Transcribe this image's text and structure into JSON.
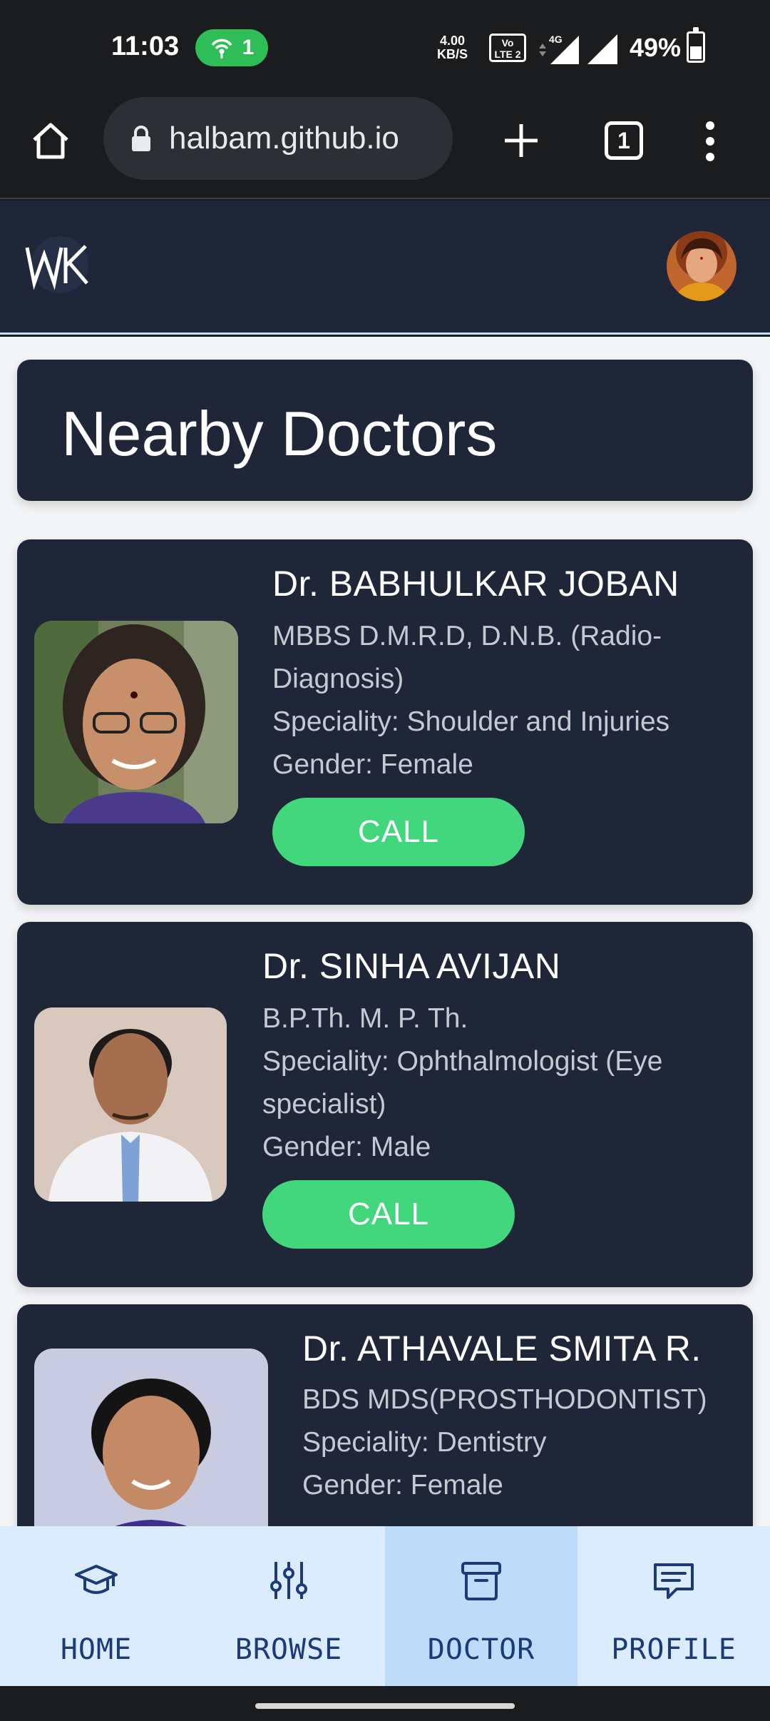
{
  "status": {
    "time": "11:03",
    "hotspot_count": "1",
    "speed_value": "4.00",
    "speed_unit": "KB/S",
    "volte_top": "Vo",
    "volte_bottom": "LTE 2",
    "network_type": "4G",
    "battery": "49%",
    "battery_level": 0.49
  },
  "browser": {
    "url": "halbam.github.io",
    "tab_count": "1"
  },
  "header": {
    "logo_text": "WK"
  },
  "page": {
    "title": "Nearby Doctors"
  },
  "doctors": [
    {
      "name": "Dr. BABHULKAR JOBAN",
      "qualification_line1": "MBBS D.M.R.D, D.N.B. (Radio-",
      "qualification_line2": "Diagnosis)",
      "speciality": "Speciality: Shoulder and Injuries",
      "gender": "Gender: Female",
      "call_label": "CALL"
    },
    {
      "name": "Dr. SINHA AVIJAN",
      "qualification_line1": "B.P.Th. M. P. Th.",
      "speciality_line1": "Speciality: Ophthalmologist (Eye",
      "speciality_line2": "specialist)",
      "gender": "Gender: Male",
      "call_label": "CALL"
    },
    {
      "name": "Dr. ATHAVALE SMITA R.",
      "qualification_line1": "BDS MDS(PROSTHODONTIST)",
      "speciality": "Speciality: Dentistry",
      "gender": "Gender: Female"
    }
  ],
  "nav": {
    "items": [
      {
        "label": "HOME",
        "icon": "graduation-cap-icon"
      },
      {
        "label": "BROWSE",
        "icon": "sliders-icon"
      },
      {
        "label": "DOCTOR",
        "icon": "archive-icon"
      },
      {
        "label": "PROFILE",
        "icon": "message-icon"
      }
    ],
    "active": "DOCTOR"
  },
  "colors": {
    "card_bg": "#1e2637",
    "accent_green": "#42d77d",
    "nav_bg": "#dcecff",
    "nav_active": "#bcdcfa",
    "nav_text": "#1b3a7a"
  }
}
